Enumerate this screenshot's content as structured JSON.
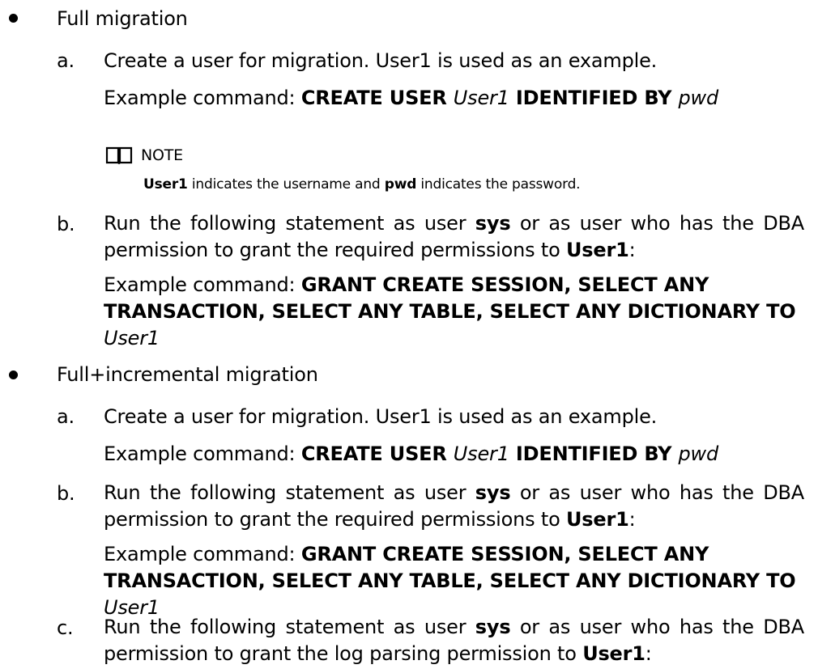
{
  "sections": [
    {
      "label": "Full migration",
      "steps": [
        {
          "letter": "a.",
          "text": "Create a user for migration. User1 is used as an example.",
          "cmd_prefix": "Example command: ",
          "cmd_bold1": "CREATE USER ",
          "cmd_italic1": "User1",
          "cmd_bold2": " IDENTIFIED BY ",
          "cmd_italic2": "pwd"
        },
        {
          "letter": "b.",
          "text1": "Run the following statement as user ",
          "user_sys": "sys",
          "text2": " or as user who has the DBA permission to grant the required permissions to ",
          "user_target": "User1",
          "text3": ":",
          "cmd_prefix": "Example command: ",
          "cmd_bold": "GRANT CREATE SESSION, SELECT ANY TRANSACTION, SELECT ANY TABLE, SELECT ANY DICTIONARY TO",
          "cmd_italic": "User1"
        }
      ],
      "note": {
        "title": "NOTE",
        "user_bold": "User1",
        "text_mid": " indicates the username and ",
        "pwd_bold": "pwd",
        "text_end": " indicates the password."
      }
    },
    {
      "label": "Full+incremental migration",
      "steps": [
        {
          "letter": "a.",
          "text": "Create a user for migration. User1 is used as an example.",
          "cmd_prefix": "Example command: ",
          "cmd_bold1": "CREATE USER ",
          "cmd_italic1": "User1",
          "cmd_bold2": " IDENTIFIED BY ",
          "cmd_italic2": "pwd"
        },
        {
          "letter": "b.",
          "text1": "Run the following statement as user ",
          "user_sys": "sys",
          "text2": " or as user who has the DBA permission to grant the required permissions to ",
          "user_target": "User1",
          "text3": ":",
          "cmd_prefix": "Example command: ",
          "cmd_bold": "GRANT CREATE SESSION, SELECT ANY TRANSACTION, SELECT ANY TABLE, SELECT ANY DICTIONARY TO",
          "cmd_italic": "User1"
        },
        {
          "letter": "c.",
          "text1": "Run the following statement as user ",
          "user_sys": "sys",
          "text2": " or as user who has the DBA permission to grant the log parsing permission to ",
          "user_target": "User1",
          "text3": ":"
        }
      ]
    }
  ]
}
